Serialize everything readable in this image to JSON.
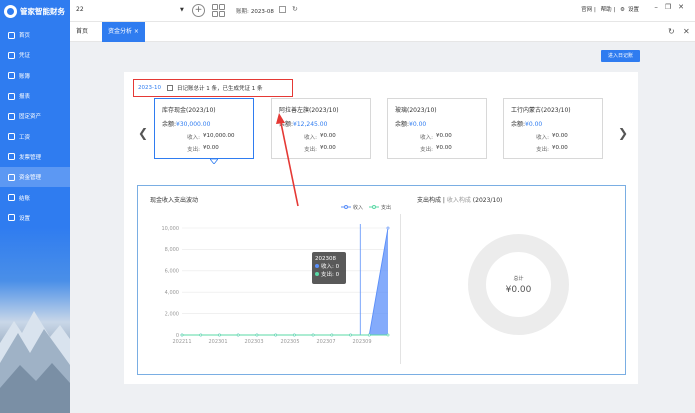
{
  "app": {
    "name": "管家智能财务"
  },
  "sidebar": {
    "items": [
      {
        "label": "首页"
      },
      {
        "label": "凭证"
      },
      {
        "label": "账簿"
      },
      {
        "label": "报表"
      },
      {
        "label": "固定资产"
      },
      {
        "label": "工资"
      },
      {
        "label": "发票管理"
      },
      {
        "label": "资金管理"
      },
      {
        "label": "结账"
      },
      {
        "label": "设置"
      }
    ],
    "active_index": 7
  },
  "topbar": {
    "account": "22",
    "period_label": "账期:",
    "period_value": "2023-08",
    "links": [
      "官网",
      "帮助",
      "设置"
    ]
  },
  "tabs": [
    {
      "label": "首页"
    },
    {
      "label": "资金分析 ×"
    }
  ],
  "enter_journal_btn": "进入日记账",
  "summary": {
    "period": "2023-10",
    "text": "日记账总计 1 条，已生成凭证 1 条"
  },
  "cards": [
    {
      "title": "库存现金(2023/10)",
      "balance_label": "余额:",
      "balance": "¥30,000.00",
      "income_label": "收入:",
      "income": "¥10,000.00",
      "expense_label": "支出:",
      "expense": "¥0.00"
    },
    {
      "title": "阿拉善左旗(2023/10)",
      "balance_label": "余额:",
      "balance": "¥12,245.00",
      "income_label": "收入:",
      "income": "¥0.00",
      "expense_label": "支出:",
      "expense": "¥0.00"
    },
    {
      "title": "玻璃(2023/10)",
      "balance_label": "余额:",
      "balance": "¥0.00",
      "income_label": "收入:",
      "income": "¥0.00",
      "expense_label": "支出:",
      "expense": "¥0.00"
    },
    {
      "title": "工行内蒙古(2023/10)",
      "balance_label": "余额:",
      "balance": "¥0.00",
      "income_label": "收入:",
      "income": "¥0.00",
      "expense_label": "支出:",
      "expense": "¥0.00"
    }
  ],
  "line_chart": {
    "title": "现金收入支出波动",
    "legend": [
      "收入",
      "支出"
    ]
  },
  "pie": {
    "title_a": "支出构成",
    "title_sep": " | ",
    "title_b": "收入构成",
    "title_c": " (2023/10)",
    "center_label": "总计",
    "center_value": "¥0.00"
  },
  "tooltip": {
    "period": "202308",
    "income": "收入: 0",
    "expense": "支出: 0"
  },
  "colors": {
    "accent": "#2f7cf0",
    "income": "#5b8ff9",
    "expense": "#5ad8a6",
    "highlight": "#e53935"
  },
  "chart_data": {
    "type": "line",
    "title": "现金收入支出波动",
    "x": [
      "202311",
      "202312",
      "202301",
      "202302",
      "202303",
      "202304",
      "202305",
      "202306",
      "202307",
      "202308",
      "202309",
      "202310"
    ],
    "x_tick_labels": [
      "202211",
      "202301",
      "202303",
      "202305",
      "202307",
      "202309"
    ],
    "series": [
      {
        "name": "收入",
        "values": [
          0,
          0,
          0,
          0,
          0,
          0,
          0,
          0,
          0,
          0,
          0,
          10000
        ]
      },
      {
        "name": "支出",
        "values": [
          0,
          0,
          0,
          0,
          0,
          0,
          0,
          0,
          0,
          0,
          0,
          0
        ]
      }
    ],
    "ylim": [
      0,
      10000
    ],
    "y_ticks": [
      0,
      2000,
      4000,
      6000,
      8000,
      10000
    ],
    "grid": true,
    "legend": "top"
  }
}
